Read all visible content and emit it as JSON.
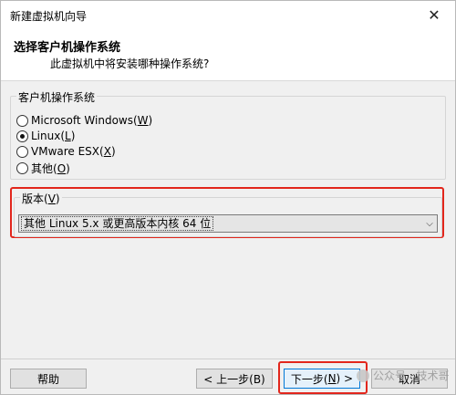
{
  "window": {
    "title": "新建虚拟机向导",
    "close_symbol": "✕"
  },
  "header": {
    "title": "选择客户机操作系统",
    "subtitle": "此虚拟机中将安装哪种操作系统?"
  },
  "os_group": {
    "legend": "客户机操作系统",
    "options": [
      {
        "pre": "Microsoft Windows(",
        "key": "W",
        "post": ")",
        "checked": false
      },
      {
        "pre": "Linux(",
        "key": "L",
        "post": ")",
        "checked": true
      },
      {
        "pre": "VMware ESX(",
        "key": "X",
        "post": ")",
        "checked": false
      },
      {
        "pre": "其他(",
        "key": "O",
        "post": ")",
        "checked": false
      }
    ]
  },
  "version_group": {
    "legend_pre": "版本(",
    "legend_key": "V",
    "legend_post": ")",
    "selected": "其他 Linux 5.x 或更高版本内核 64 位",
    "arrow": "⌵"
  },
  "buttons": {
    "help": "帮助",
    "back": "< 上一步(B)",
    "next_pre": "下一步(",
    "next_key": "N",
    "next_post": ") >",
    "cancel": "取消"
  },
  "watermark": {
    "text": "公众号 · 技术哥"
  },
  "colors": {
    "highlight_box": "#e2261c",
    "accent": "#0078d7"
  }
}
